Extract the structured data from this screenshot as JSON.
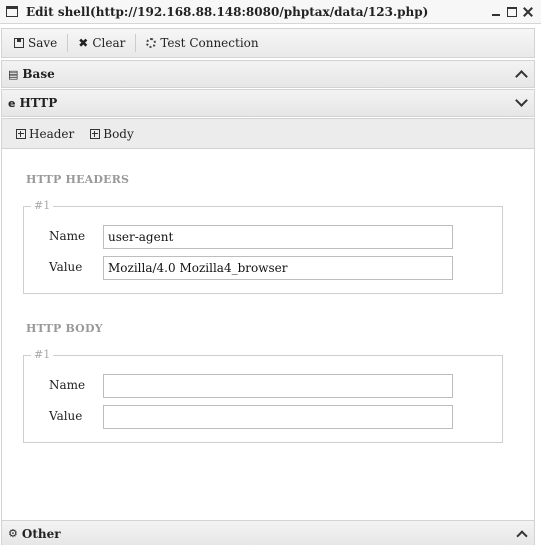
{
  "window": {
    "title": "Edit shell(http://192.168.88.148:8080/phptax/data/123.php)"
  },
  "toolbar": {
    "save_label": "Save",
    "clear_label": "Clear",
    "test_label": "Test Connection"
  },
  "panels": {
    "base_label": "Base",
    "http_label": "HTTP",
    "other_label": "Other"
  },
  "tabs": {
    "header_label": "Header",
    "body_label": "Body"
  },
  "headers_section": {
    "title": "HTTP HEADERS",
    "legend": "#1",
    "name_label": "Name",
    "value_label": "Value",
    "name_value": "user-agent",
    "value_value": "Mozilla/4.0 Mozilla4_browser"
  },
  "body_section": {
    "title": "HTTP BODY",
    "legend": "#1",
    "name_label": "Name",
    "value_label": "Value",
    "name_value": "",
    "value_value": ""
  }
}
